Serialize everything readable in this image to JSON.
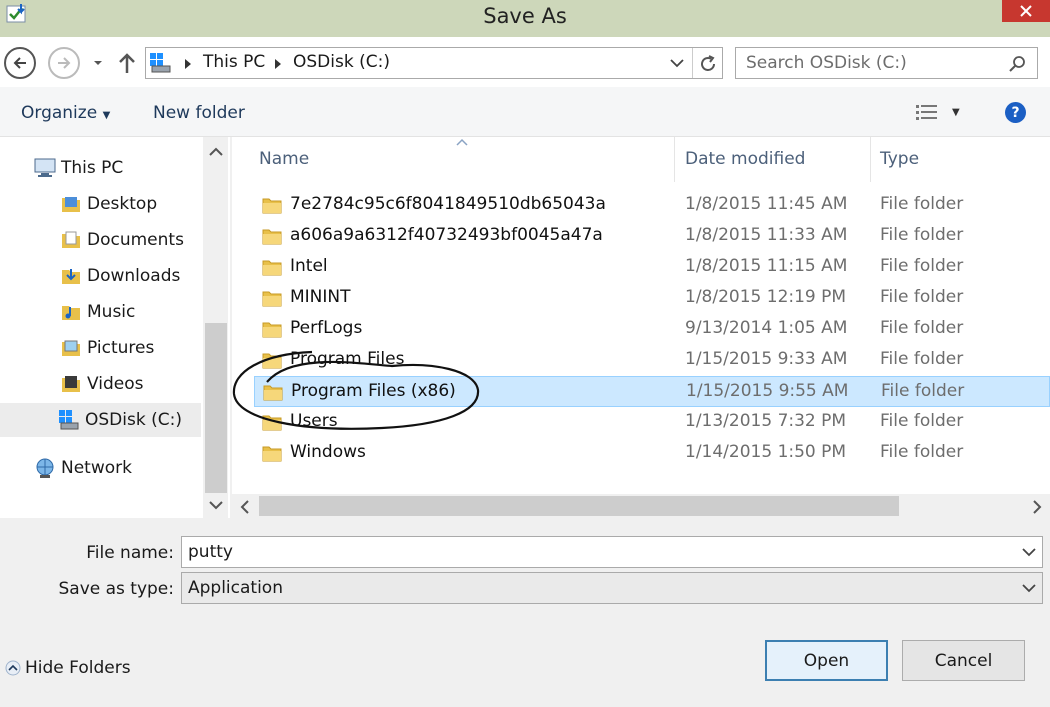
{
  "window": {
    "title": "Save As"
  },
  "address": {
    "crumbs": [
      "This PC",
      "OSDisk (C:)"
    ],
    "search_placeholder": "Search OSDisk (C:)"
  },
  "toolbar": {
    "organize": "Organize",
    "new_folder": "New folder"
  },
  "nav": {
    "this_pc": "This PC",
    "items": [
      "Desktop",
      "Documents",
      "Downloads",
      "Music",
      "Pictures",
      "Videos",
      "OSDisk (C:)"
    ],
    "network": "Network"
  },
  "columns": {
    "name": "Name",
    "date": "Date modified",
    "type": "Type"
  },
  "files": [
    {
      "name": "7e2784c95c6f8041849510db65043a",
      "date": "1/8/2015 11:45 AM",
      "type": "File folder"
    },
    {
      "name": "a606a9a6312f40732493bf0045a47a",
      "date": "1/8/2015 11:33 AM",
      "type": "File folder"
    },
    {
      "name": "Intel",
      "date": "1/8/2015 11:15 AM",
      "type": "File folder"
    },
    {
      "name": "MININT",
      "date": "1/8/2015 12:19 PM",
      "type": "File folder"
    },
    {
      "name": "PerfLogs",
      "date": "9/13/2014 1:05 AM",
      "type": "File folder"
    },
    {
      "name": "Program Files",
      "date": "1/15/2015 9:33 AM",
      "type": "File folder"
    },
    {
      "name": "Program Files (x86)",
      "date": "1/15/2015 9:55 AM",
      "type": "File folder"
    },
    {
      "name": "Users",
      "date": "1/13/2015 7:32 PM",
      "type": "File folder"
    },
    {
      "name": "Windows",
      "date": "1/14/2015 1:50 PM",
      "type": "File folder"
    }
  ],
  "form": {
    "file_name_label": "File name:",
    "file_name_value": "putty",
    "save_type_label": "Save as type:",
    "save_type_value": "Application"
  },
  "buttons": {
    "hide_folders": "Hide Folders",
    "open": "Open",
    "cancel": "Cancel"
  },
  "colors": {
    "titlebar": "#cdd7ba",
    "selection": "#cce8ff",
    "close": "#c7372f"
  }
}
